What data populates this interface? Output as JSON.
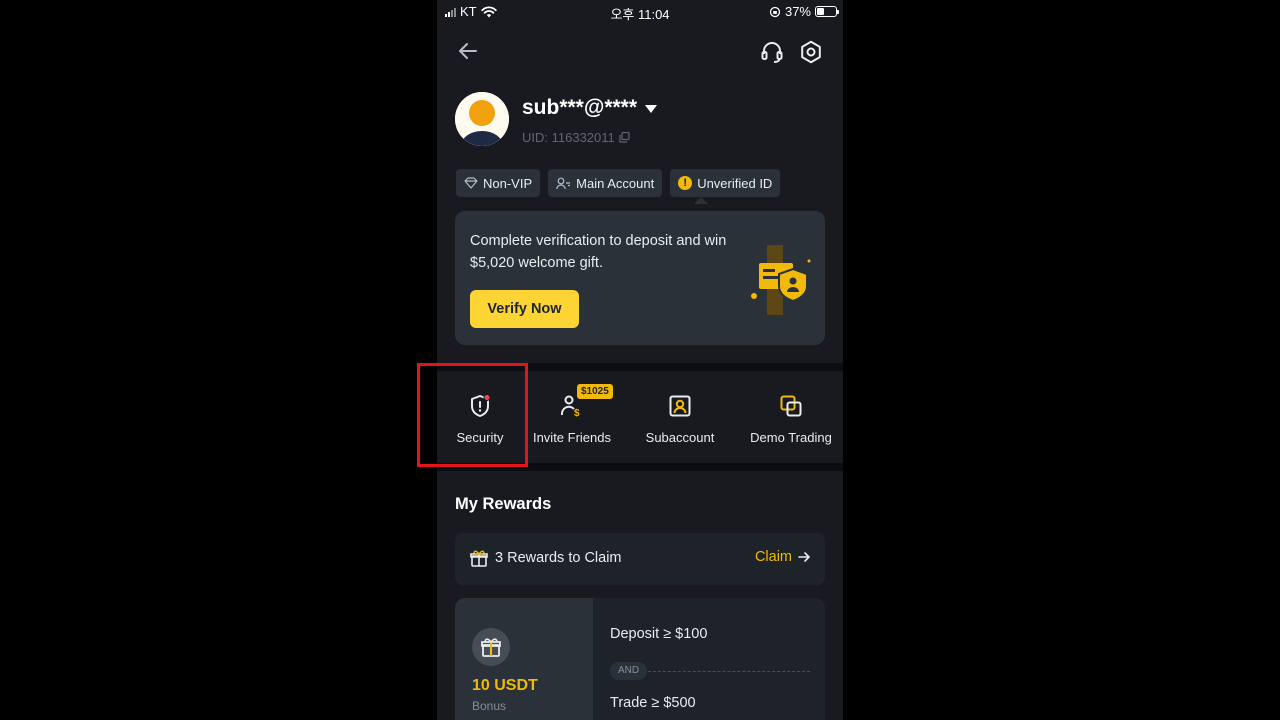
{
  "status_bar": {
    "carrier": "KT",
    "time": "오후 11:04",
    "battery": "37%",
    "battery_level": 0.37
  },
  "profile": {
    "username": "sub***@****",
    "uid": "UID: 116332011"
  },
  "tags": {
    "vip": "Non-VIP",
    "account": "Main Account",
    "verification": "Unverified ID"
  },
  "verify_card": {
    "message": "Complete verification to deposit and win $5,020 welcome gift.",
    "button": "Verify Now"
  },
  "quick_actions": [
    {
      "label": "Security",
      "icon": "shield-alert-icon"
    },
    {
      "label": "Invite Friends",
      "icon": "invite-friends-icon",
      "badge": "$1025"
    },
    {
      "label": "Subaccount",
      "icon": "subaccount-icon"
    },
    {
      "label": "Demo Trading",
      "icon": "demo-trading-icon"
    }
  ],
  "rewards": {
    "title": "My Rewards",
    "claim_text": "3 Rewards to Claim",
    "claim_link": "Claim",
    "card": {
      "amount": "10 USDT",
      "sub": "Bonus",
      "condition_1": "Deposit ≥ $100",
      "and": "AND",
      "condition_2": "Trade ≥ $500"
    }
  },
  "colors": {
    "accent": "#f0b90b",
    "button": "#fcd535",
    "background": "#181a20",
    "card": "#2b3139",
    "highlight": "#e5141b"
  }
}
